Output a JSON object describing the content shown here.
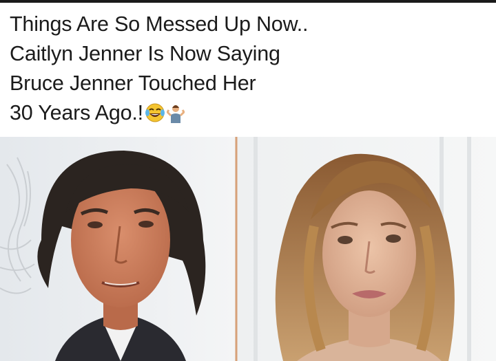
{
  "caption": {
    "lines": [
      "Things Are So Messed Up Now..",
      "Caitlyn Jenner Is Now Saying",
      "Bruce Jenner Touched Her",
      "30 Years Ago.!"
    ],
    "emojis": [
      "face-with-tears-of-joy-icon",
      "person-shrugging-icon"
    ]
  },
  "photos": {
    "left": "man-portrait-photo",
    "right": "woman-portrait-photo"
  },
  "colors": {
    "caption_text": "#1b1b1b",
    "skin_left": "#c87a5a",
    "hair_left": "#2b2420",
    "hair_right": "#9a6a3a",
    "skin_right": "#e0b59a"
  }
}
